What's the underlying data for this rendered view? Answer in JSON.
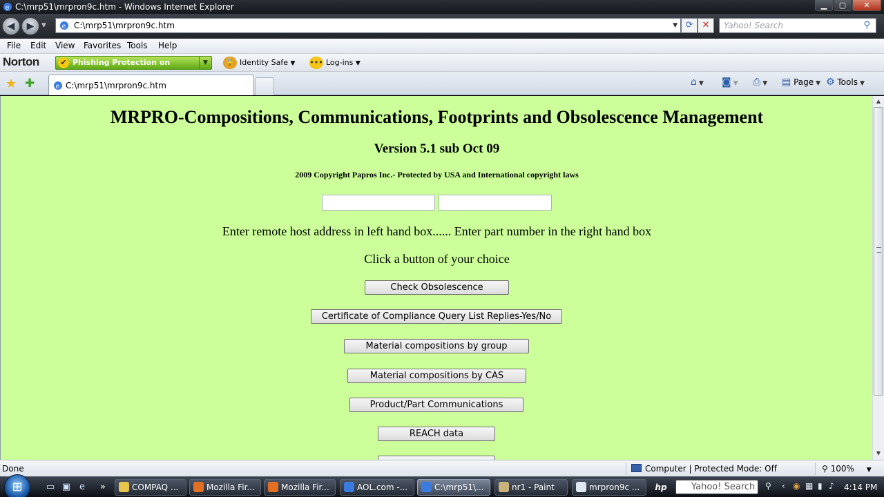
{
  "window": {
    "title": "C:\\mrp51\\mrpron9c.htm - Windows Internet Explorer",
    "controls": {
      "minimize": "▁",
      "maximize": "▢",
      "close": "✕"
    }
  },
  "addressbar": {
    "url": "C:\\mrp51\\mrpron9c.htm",
    "search_placeholder": "Yahoo! Search"
  },
  "menu": [
    "File",
    "Edit",
    "View",
    "Favorites",
    "Tools",
    "Help"
  ],
  "norton": {
    "logo": "Norton",
    "phishing": "Phishing Protection on",
    "identity": "Identity Safe",
    "logins": "Log-ins"
  },
  "tabs": {
    "active_label": "C:\\mrp51\\mrpron9c.htm"
  },
  "commandbar": {
    "page": "Page",
    "tools": "Tools"
  },
  "page": {
    "title": "MRPRO-Compositions, Communications, Footprints and Obsolescence Management",
    "version": "Version 5.1 sub Oct 09",
    "copyright": "2009 Copyright Papros Inc.- Protected by USA and International copyright laws",
    "left_input_value": "",
    "right_input_value": "",
    "instruction": "Enter remote host address in left hand box...... Enter part number in the right hand box",
    "prompt": "Click a button of your choice",
    "buttons": [
      "Check Obsolescence",
      "Certificate of Compliance Query List Replies-Yes/No",
      "Material compositions by group",
      "Material compositions by CAS",
      "Product/Part Communications",
      "REACH data"
    ]
  },
  "status": {
    "text": "Done",
    "zone": "Computer | Protected Mode: Off",
    "zoom": "100%"
  },
  "taskbar": {
    "items": [
      "COMPAQ ...",
      "Mozilla Fir...",
      "Mozilla Fir...",
      "AOL.com -...",
      "C:\\mrp51\\...",
      "nr1 - Paint",
      "mrpron9c ..."
    ],
    "search": "Yahoo! Search",
    "time": "4:14 PM"
  },
  "colors": {
    "page_background": "#ccff99",
    "phishing_green": "#5fa815"
  }
}
